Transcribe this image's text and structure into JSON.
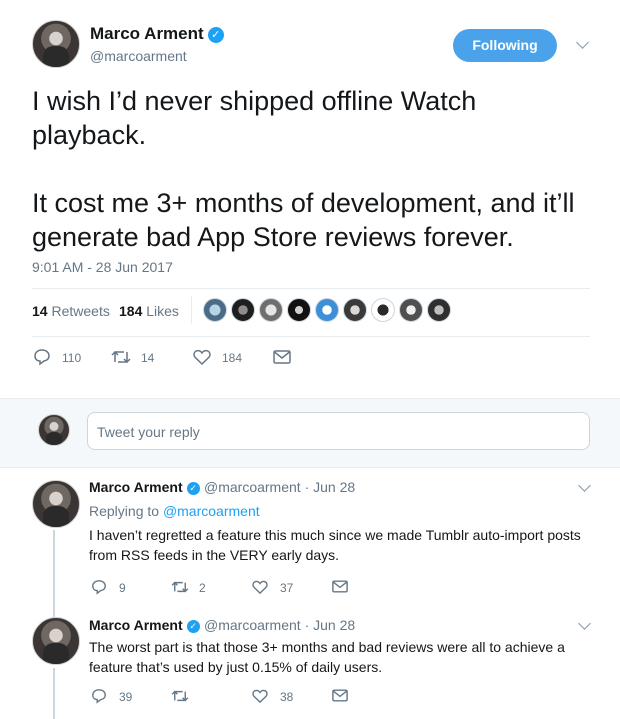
{
  "tweet": {
    "author_name": "Marco Arment",
    "author_handle": "@marcoarment",
    "follow_label": "Following",
    "text": "I wish I’d never shipped offline Watch playback.\n\nIt cost me 3+ months of development, and it’ll generate bad App Store reviews forever.",
    "timestamp": "9:01 AM - 28 Jun 2017",
    "retweets_count": "14",
    "retweets_label": "Retweets",
    "likes_count": "184",
    "likes_label": "Likes",
    "actions": {
      "replies": "110",
      "retweets": "14",
      "likes": "184"
    }
  },
  "reply_box": {
    "placeholder": "Tweet your reply"
  },
  "replies": [
    {
      "name": "Marco Arment",
      "handle": "@marcoarment",
      "date": "· Jun 28",
      "replying_prefix": "Replying to ",
      "replying_to": "@marcoarment",
      "text_line1": "I haven’t regretted a feature this much since we made Tumblr auto-import posts",
      "text_line2": "from RSS feeds in the VERY early days.",
      "replies": "9",
      "retweets": "2",
      "likes": "37"
    },
    {
      "name": "Marco Arment",
      "handle": "@marcoarment",
      "date": "· Jun 28",
      "text_line1": "The worst part is that those 3+ months and bad reviews were all to achieve a",
      "text_line2": "feature that’s used by just 0.15% of daily users.",
      "replies": "39",
      "retweets": "",
      "likes": "38"
    }
  ],
  "colors": {
    "accent": "#1da1f2",
    "follow_button": "#4aa3ea",
    "muted": "#657786"
  }
}
